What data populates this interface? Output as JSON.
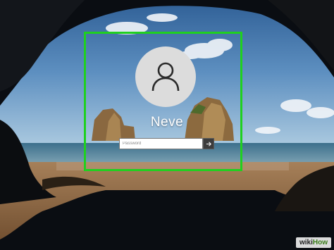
{
  "login": {
    "username": "Neve",
    "password_placeholder": "Password"
  },
  "watermark": {
    "part1": "wiki",
    "part2": "How"
  },
  "colors": {
    "highlight": "#1fd01f",
    "avatar_bg": "#dcdcdc",
    "submit_bg": "#3c3c3c"
  },
  "icons": {
    "avatar": "user-icon",
    "submit": "arrow-right-icon"
  }
}
